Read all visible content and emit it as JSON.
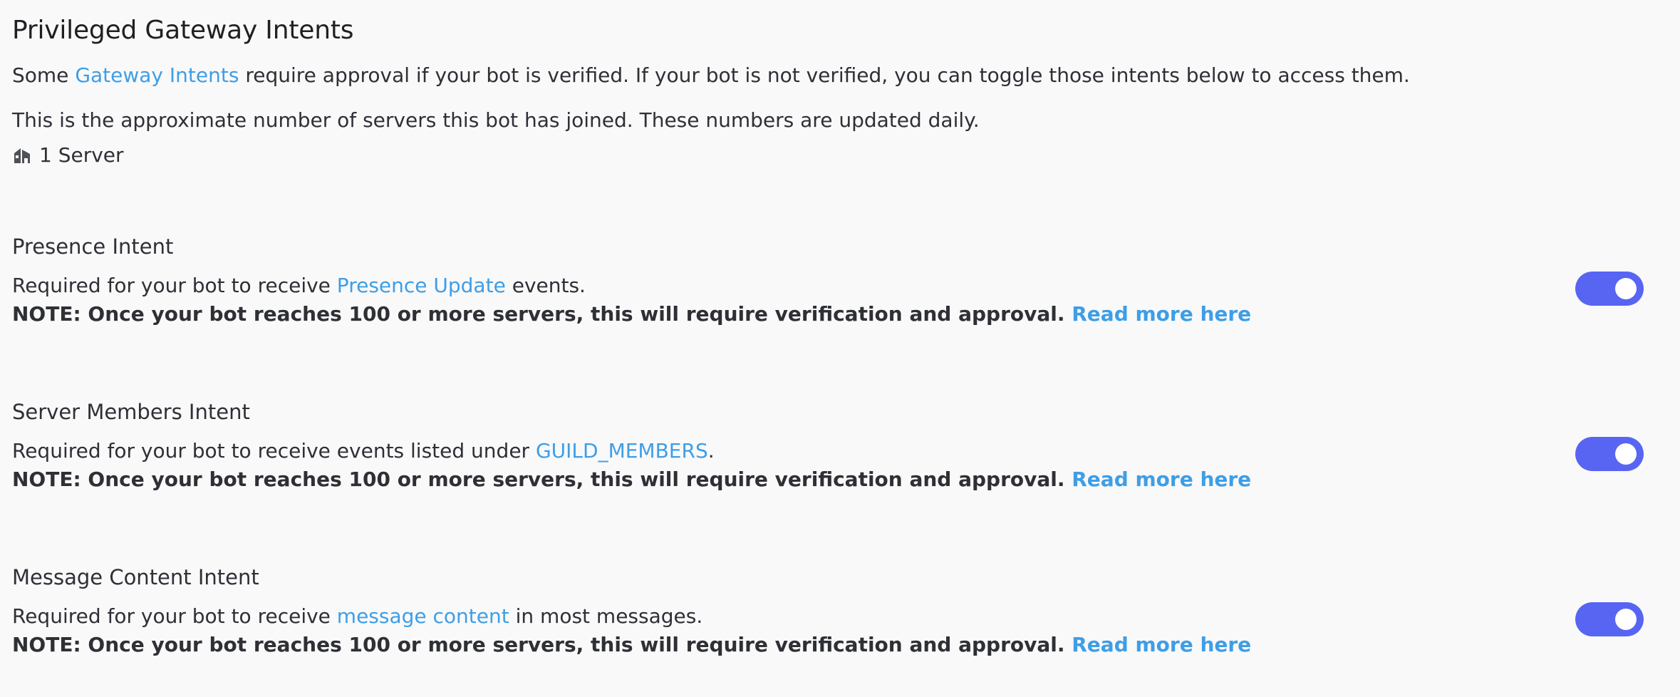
{
  "header": {
    "title": "Privileged Gateway Intents"
  },
  "intro": {
    "prefix": "Some ",
    "link": "Gateway Intents",
    "suffix": " require approval if your bot is verified. If your bot is not verified, you can toggle those intents below to access them."
  },
  "servers": {
    "note": "This is the approximate number of servers this bot has joined. These numbers are updated daily.",
    "icon": "server-icon",
    "count_label": "1 Server"
  },
  "intents": [
    {
      "title": "Presence Intent",
      "desc_prefix": "Required for your bot to receive ",
      "desc_link": "Presence Update",
      "desc_suffix": " events.",
      "note": "NOTE: Once your bot reaches 100 or more servers, this will require verification and approval.",
      "read_more": "Read more here",
      "enabled": true
    },
    {
      "title": "Server Members Intent",
      "desc_prefix": "Required for your bot to receive events listed under ",
      "desc_link": "GUILD_MEMBERS",
      "desc_suffix": ".",
      "note": "NOTE: Once your bot reaches 100 or more servers, this will require verification and approval.",
      "read_more": "Read more here",
      "enabled": true
    },
    {
      "title": "Message Content Intent",
      "desc_prefix": "Required for your bot to receive ",
      "desc_link": "message content",
      "desc_suffix": " in most messages.",
      "note": "NOTE: Once your bot reaches 100 or more servers, this will require verification and approval.",
      "read_more": "Read more here",
      "enabled": true
    }
  ],
  "colors": {
    "accent_link": "#3e9ee6",
    "toggle_on": "#5865f2",
    "text": "#2e3035",
    "background": "#f9f9fa"
  }
}
